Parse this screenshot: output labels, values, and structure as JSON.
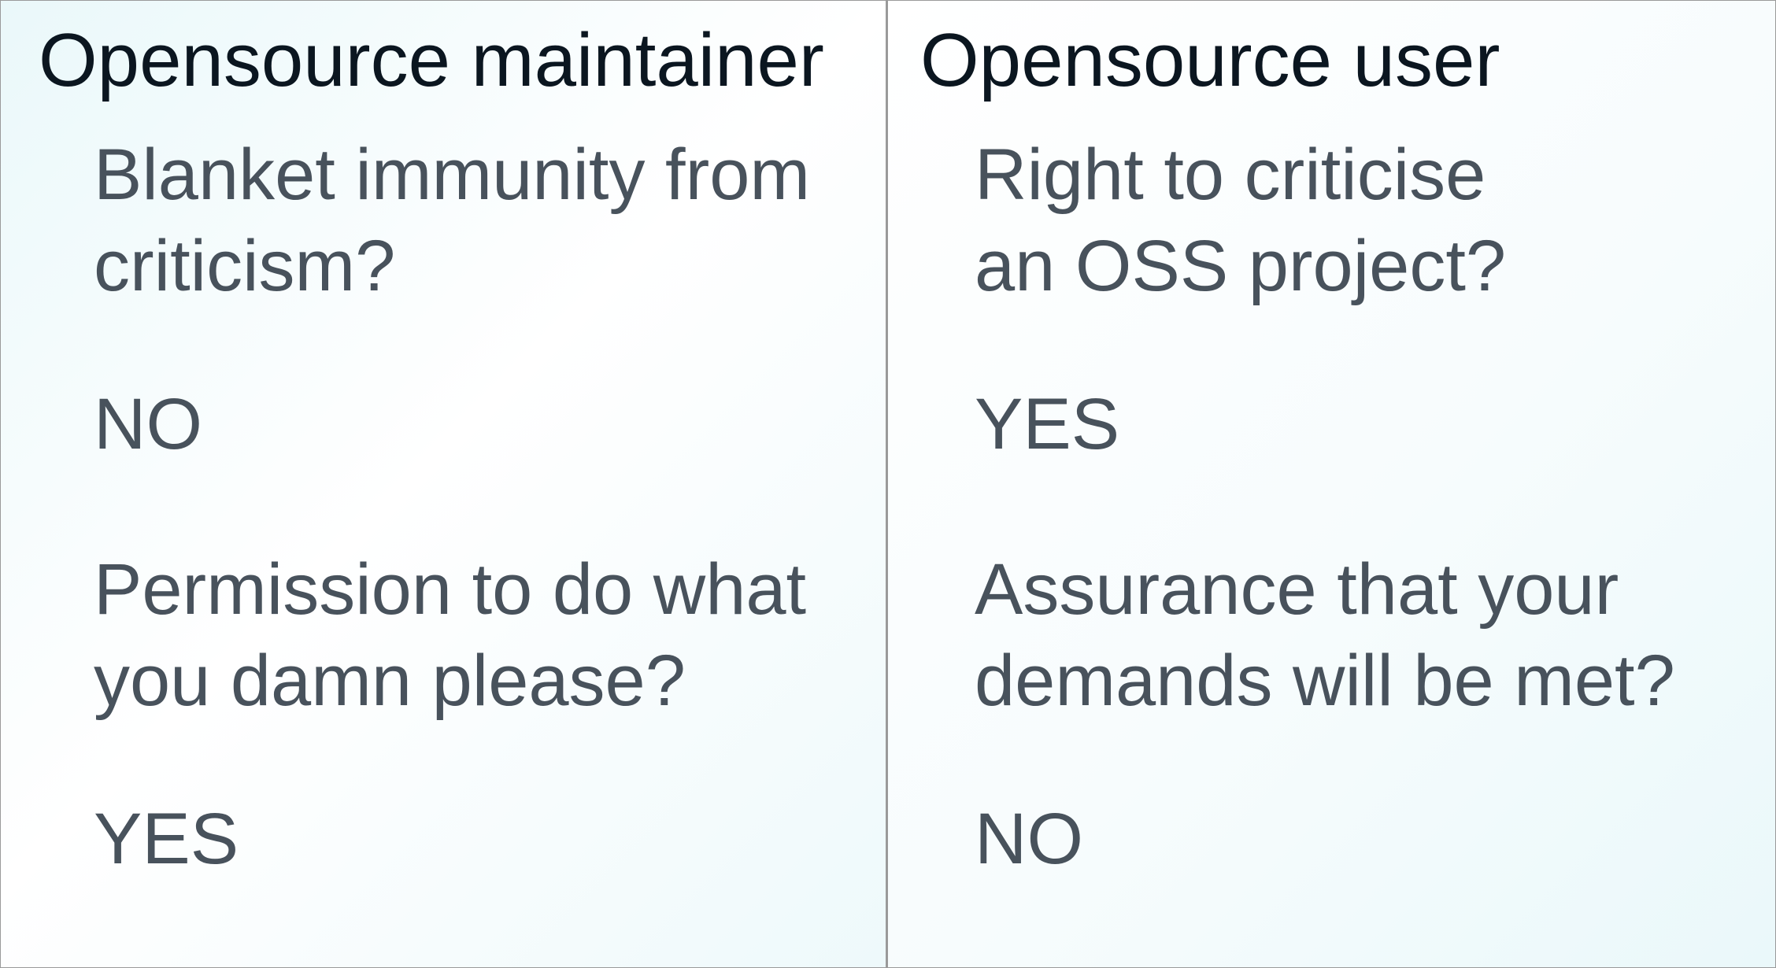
{
  "columns": [
    {
      "heading": "Opensource maintainer",
      "items": [
        {
          "lines": [
            "Blanket immunity from",
            "criticism?"
          ]
        },
        {
          "lines": [
            "NO"
          ]
        },
        {
          "lines": [
            "Permission to do what",
            "you damn please?"
          ]
        },
        {
          "lines": [
            "YES"
          ]
        }
      ]
    },
    {
      "heading": "Opensource user",
      "items": [
        {
          "lines": [
            "Right to criticise",
            "an OSS project?"
          ]
        },
        {
          "lines": [
            "YES"
          ]
        },
        {
          "lines": [
            "Assurance that your",
            "demands will be met?"
          ]
        },
        {
          "lines": [
            "NO"
          ]
        }
      ]
    }
  ]
}
